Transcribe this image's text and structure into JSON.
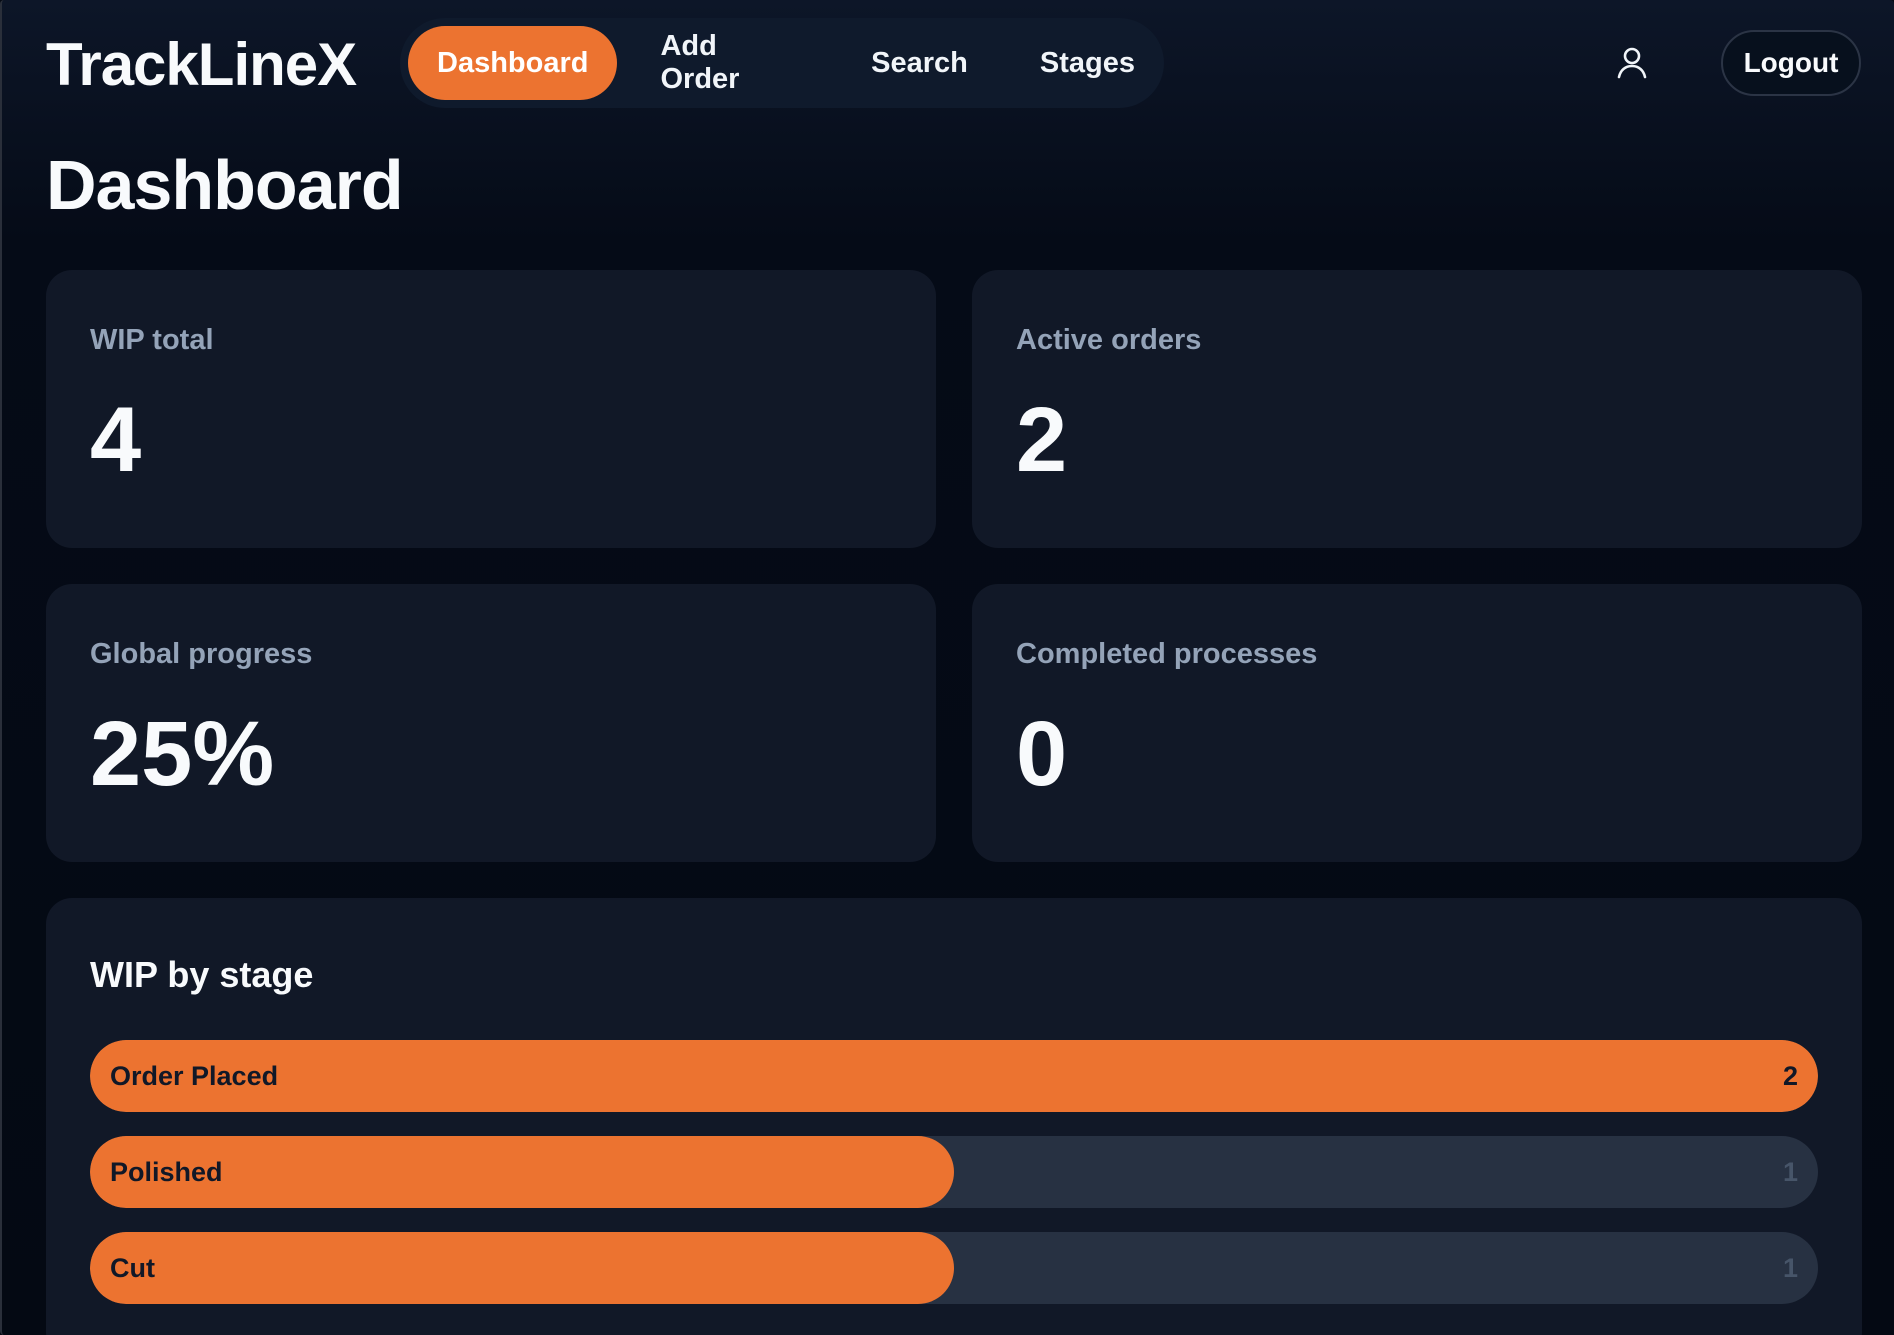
{
  "app": {
    "name": "TrackLineX"
  },
  "nav": {
    "items": [
      {
        "label": "Dashboard",
        "active": true
      },
      {
        "label": "Add Order",
        "active": false
      },
      {
        "label": "Search",
        "active": false
      },
      {
        "label": "Stages",
        "active": false
      }
    ],
    "user_icon": "user-icon",
    "logout_label": "Logout"
  },
  "page": {
    "title": "Dashboard"
  },
  "stats": {
    "wip_total": {
      "label": "WIP total",
      "value": "4"
    },
    "active_orders": {
      "label": "Active orders",
      "value": "2"
    },
    "global_progress": {
      "label": "Global progress",
      "value": "25%"
    },
    "completed_processes": {
      "label": "Completed processes",
      "value": "0"
    }
  },
  "wip_by_stage": {
    "title": "WIP by stage",
    "max": 2,
    "stages": [
      {
        "label": "Order Placed",
        "count": "2"
      },
      {
        "label": "Polished",
        "count": "1"
      },
      {
        "label": "Cut",
        "count": "1"
      }
    ]
  },
  "colors": {
    "accent": "#ec7330",
    "card_bg": "#111827",
    "track_bg": "#273142",
    "muted_text": "#94a3b8"
  }
}
